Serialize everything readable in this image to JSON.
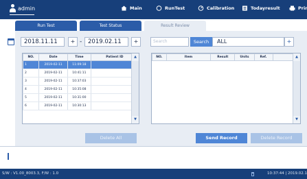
{
  "header": {
    "user": "admin",
    "nav": [
      {
        "label": "Main",
        "icon": "home-icon"
      },
      {
        "label": "RunTest",
        "icon": "flask-icon"
      },
      {
        "label": "Calibration",
        "icon": "gauge-icon"
      },
      {
        "label": "Todayresult",
        "icon": "list-icon"
      },
      {
        "label": "Prin",
        "icon": "printer-icon"
      }
    ]
  },
  "tabs": [
    {
      "label": "Run Test",
      "active": false
    },
    {
      "label": "Test Status",
      "active": false
    },
    {
      "label": "Result Review",
      "active": true
    }
  ],
  "filters": {
    "date_from": "2018.11.11",
    "date_to": "2019.02.11",
    "plus": "+",
    "dash": "-",
    "search_placeholder": "Search",
    "search_button": "Search",
    "select_value": "ALL"
  },
  "records": {
    "columns": [
      "NO.",
      "Date",
      "Time",
      "Patient ID"
    ],
    "rows": [
      [
        "1",
        "2019-02-11",
        "11:09:18",
        ""
      ],
      [
        "2",
        "2019-02-11",
        "10:41:11",
        ""
      ],
      [
        "3",
        "2019-02-11",
        "10:37:03",
        ""
      ],
      [
        "4",
        "2019-02-11",
        "10:35:08",
        ""
      ],
      [
        "5",
        "2019-02-11",
        "10:31:00",
        ""
      ],
      [
        "6",
        "2019-02-11",
        "10:30:13",
        ""
      ]
    ],
    "selected_row": 0
  },
  "results": {
    "columns": [
      "NO.",
      "Item",
      "Result",
      "Units",
      "Ref."
    ]
  },
  "buttons": {
    "delete_all": "Delete All",
    "send_record": "Send Record",
    "delete_record": "Delete Record"
  },
  "footer": {
    "version": "S/W : V1.00_8003.3, F/W : 1.0",
    "time": "10:37:44 | 2019.02.1"
  },
  "colors": {
    "header_bg": "#173f7a",
    "accent": "#4f86d6",
    "disabled": "#a9c3e6"
  }
}
